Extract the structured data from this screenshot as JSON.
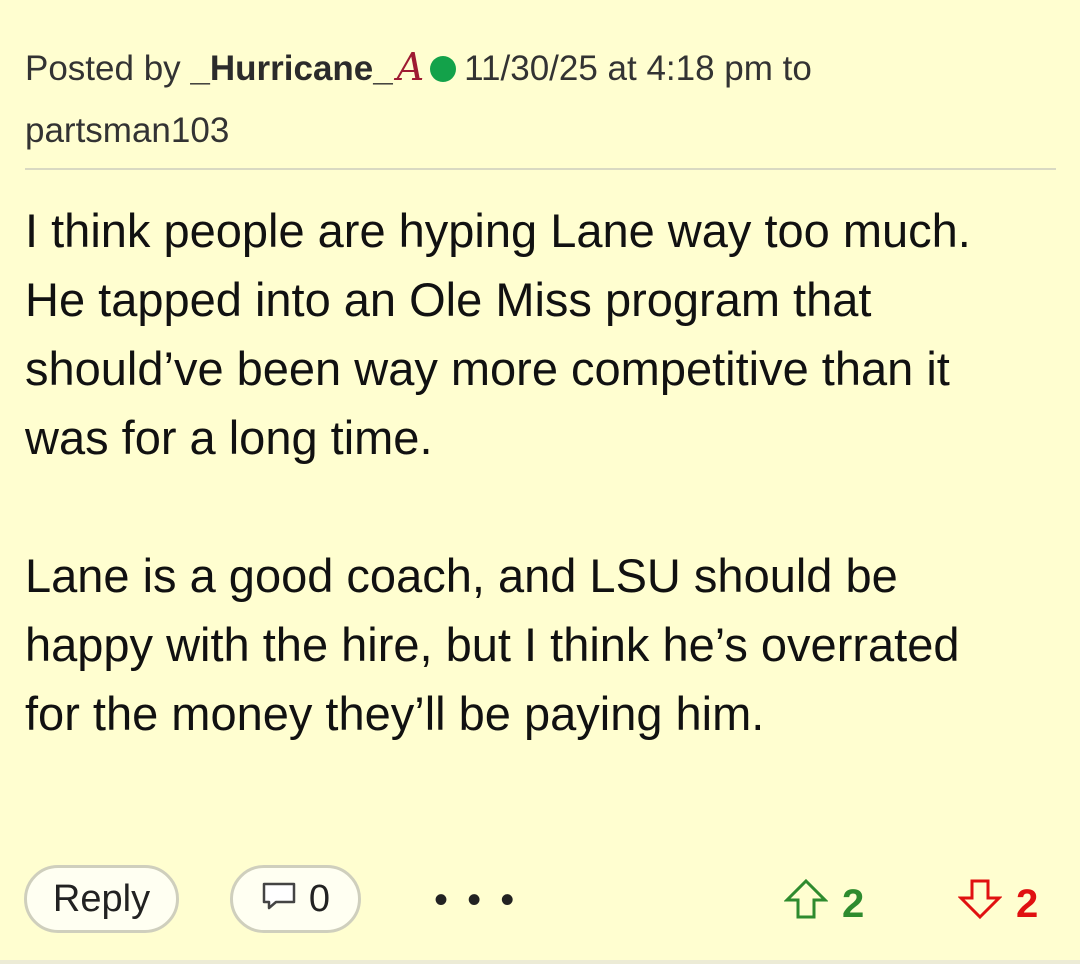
{
  "header": {
    "posted_by_prefix": "Posted by",
    "author": "_Hurricane_",
    "team_logo": "A",
    "team_logo_icon": "alabama-script-a-icon",
    "online_color": "#13a24a",
    "timestamp": "11/30/25 at 4:18 pm",
    "to_label": "to",
    "recipient": "partsman103"
  },
  "body": {
    "paragraphs": [
      "I think people are hyping Lane way too much.\nHe tapped into an Ole Miss program that\nshould’ve been way more competitive than it\nwas for a long time.",
      "Lane is a good coach, and LSU should be\nhappy with the hire, but I think he’s overrated\nfor the money they’ll be paying him."
    ]
  },
  "actions": {
    "reply_label": "Reply",
    "comment_count": "0",
    "more_label": "• • •",
    "upvotes": "2",
    "downvotes": "2",
    "upvote_color": "#2e8b2e",
    "downvote_color": "#e01111"
  }
}
